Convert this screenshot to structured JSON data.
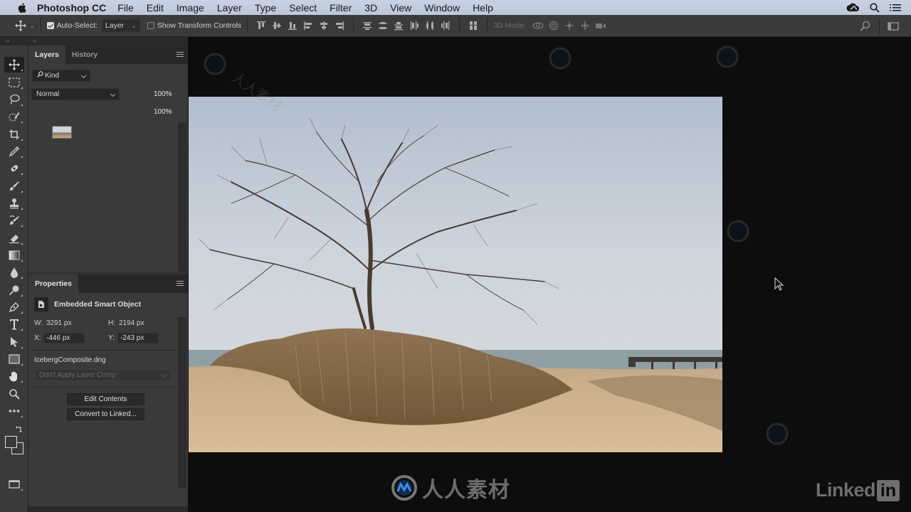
{
  "menubar": {
    "app_name": "Photoshop CC",
    "items": [
      "File",
      "Edit",
      "Image",
      "Layer",
      "Type",
      "Select",
      "Filter",
      "3D",
      "View",
      "Window",
      "Help"
    ],
    "status_icons": [
      "creative-cloud-icon",
      "spotlight-search-icon",
      "notification-list-icon"
    ]
  },
  "options_bar": {
    "auto_select_label": "Auto-Select:",
    "auto_select_checked": true,
    "auto_select_target": "Layer",
    "show_transform_label": "Show Transform Controls",
    "show_transform_checked": false,
    "mode_3d_label": "3D Mode:"
  },
  "tools": [
    {
      "name": "move-tool",
      "glyph": "move",
      "active": true
    },
    {
      "name": "rectangular-marquee-tool",
      "glyph": "marquee"
    },
    {
      "name": "lasso-tool",
      "glyph": "lasso"
    },
    {
      "name": "quick-selection-tool",
      "glyph": "quick-select"
    },
    {
      "name": "crop-tool",
      "glyph": "crop"
    },
    {
      "name": "eyedropper-tool",
      "glyph": "eyedropper"
    },
    {
      "name": "healing-brush-tool",
      "glyph": "bandage"
    },
    {
      "name": "brush-tool",
      "glyph": "brush"
    },
    {
      "name": "clone-stamp-tool",
      "glyph": "stamp"
    },
    {
      "name": "history-brush-tool",
      "glyph": "history-brush"
    },
    {
      "name": "eraser-tool",
      "glyph": "eraser"
    },
    {
      "name": "gradient-tool",
      "glyph": "gradient"
    },
    {
      "name": "blur-tool",
      "glyph": "drop"
    },
    {
      "name": "dodge-tool",
      "glyph": "dodge"
    },
    {
      "name": "pen-tool",
      "glyph": "pen"
    },
    {
      "name": "type-tool",
      "glyph": "T"
    },
    {
      "name": "path-selection-tool",
      "glyph": "arrow"
    },
    {
      "name": "rectangle-tool",
      "glyph": "rect"
    },
    {
      "name": "hand-tool",
      "glyph": "hand"
    },
    {
      "name": "zoom-tool",
      "glyph": "zoom"
    },
    {
      "name": "edit-toolbar",
      "glyph": "dots"
    }
  ],
  "layers_panel": {
    "tabs": [
      "Layers",
      "History"
    ],
    "active_tab": "Layers",
    "filter_kind": "Kind",
    "blend_mode": "Normal",
    "opacity": "100%",
    "fill": "100%"
  },
  "properties_panel": {
    "title": "Properties",
    "object_type": "Embedded Smart Object",
    "w_label": "W:",
    "w_value": "3291 px",
    "h_label": "H:",
    "h_value": "2194 px",
    "x_label": "X:",
    "x_value": "-446 px",
    "y_label": "Y:",
    "y_value": "-243 px",
    "filename": "IcebergComposite.dng",
    "layer_comp": "Don't Apply Layer Comp",
    "edit_contents_label": "Edit Contents",
    "convert_label": "Convert to Linked..."
  },
  "canvas": {
    "image_subject": "bare tree on grassy sand dune by the shore",
    "watermark_text": "人人素材",
    "brand_logo_text": "人人素材",
    "linkedin_text": "Linked",
    "linkedin_box": "in"
  }
}
